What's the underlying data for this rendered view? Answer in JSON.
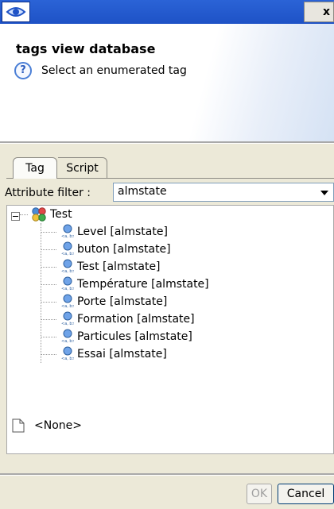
{
  "window": {
    "close_label": "x"
  },
  "header": {
    "title": "tags view database",
    "help_icon": "question-circle-icon",
    "message": "Select an enumerated tag"
  },
  "tabs": [
    {
      "label": "Tag",
      "active": true
    },
    {
      "label": "Script",
      "active": false
    }
  ],
  "filter": {
    "label": "Attribute filter :",
    "value": "almstate"
  },
  "tree": {
    "root": {
      "label": "Test",
      "expanded": true,
      "icon": "tag-group-icon"
    },
    "children": [
      {
        "label": "Level [almstate]",
        "icon": "enumerated-tag-icon"
      },
      {
        "label": "buton [almstate]",
        "icon": "enumerated-tag-icon"
      },
      {
        "label": "Test [almstate]",
        "icon": "enumerated-tag-icon"
      },
      {
        "label": "Température [almstate]",
        "icon": "enumerated-tag-icon"
      },
      {
        "label": "Porte [almstate]",
        "icon": "enumerated-tag-icon"
      },
      {
        "label": "Formation [almstate]",
        "icon": "enumerated-tag-icon"
      },
      {
        "label": "Particules [almstate]",
        "icon": "enumerated-tag-icon"
      },
      {
        "label": "Essai [almstate]",
        "icon": "enumerated-tag-icon"
      }
    ],
    "none_item": {
      "label": "<None>",
      "icon": "blank-page-icon"
    }
  },
  "buttons": {
    "ok": "OK",
    "cancel": "Cancel"
  },
  "colors": {
    "titlebar": "#2b63d6",
    "dialog_bg": "#ece9d8",
    "accent": "#4b7fd6"
  }
}
